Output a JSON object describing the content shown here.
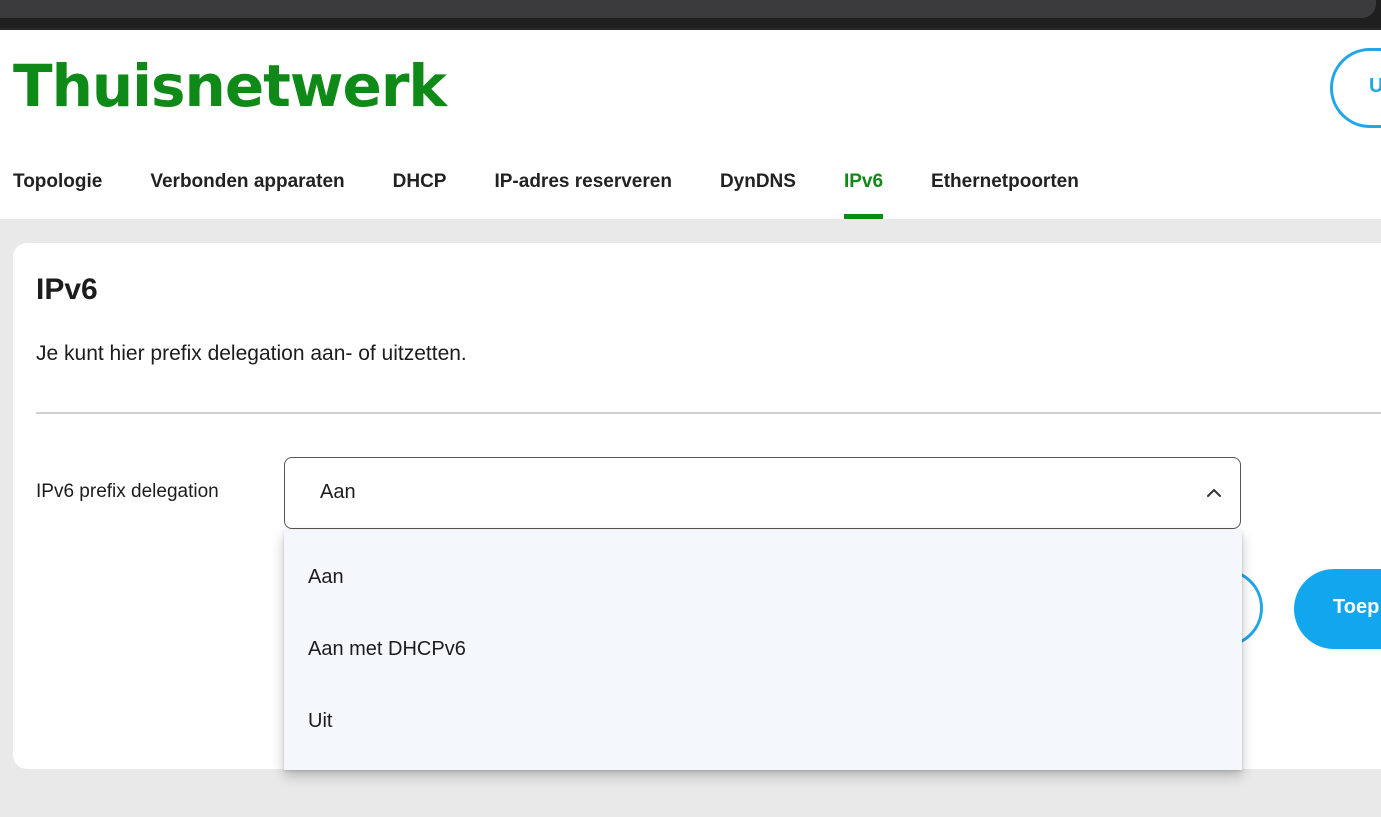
{
  "brand": "Thuisnetwerk",
  "user_button": "U",
  "nav": [
    {
      "label": "Topologie",
      "active": false
    },
    {
      "label": "Verbonden apparaten",
      "active": false
    },
    {
      "label": "DHCP",
      "active": false
    },
    {
      "label": "IP-adres reserveren",
      "active": false
    },
    {
      "label": "DynDNS",
      "active": false
    },
    {
      "label": "IPv6",
      "active": true
    },
    {
      "label": "Ethernetpoorten",
      "active": false
    }
  ],
  "card": {
    "title": "IPv6",
    "description": "Je kunt hier prefix delegation aan- of uitzetten."
  },
  "field": {
    "label": "IPv6 prefix delegation",
    "value": "Aan",
    "options": [
      "Aan",
      "Aan met DHCPv6",
      "Uit"
    ]
  },
  "buttons": {
    "apply_label": "Toep"
  },
  "colors": {
    "brand_green": "#0f8a18",
    "accent_blue": "#12a6ee"
  },
  "icons": {
    "select_chevron": "chevron-up-icon"
  }
}
